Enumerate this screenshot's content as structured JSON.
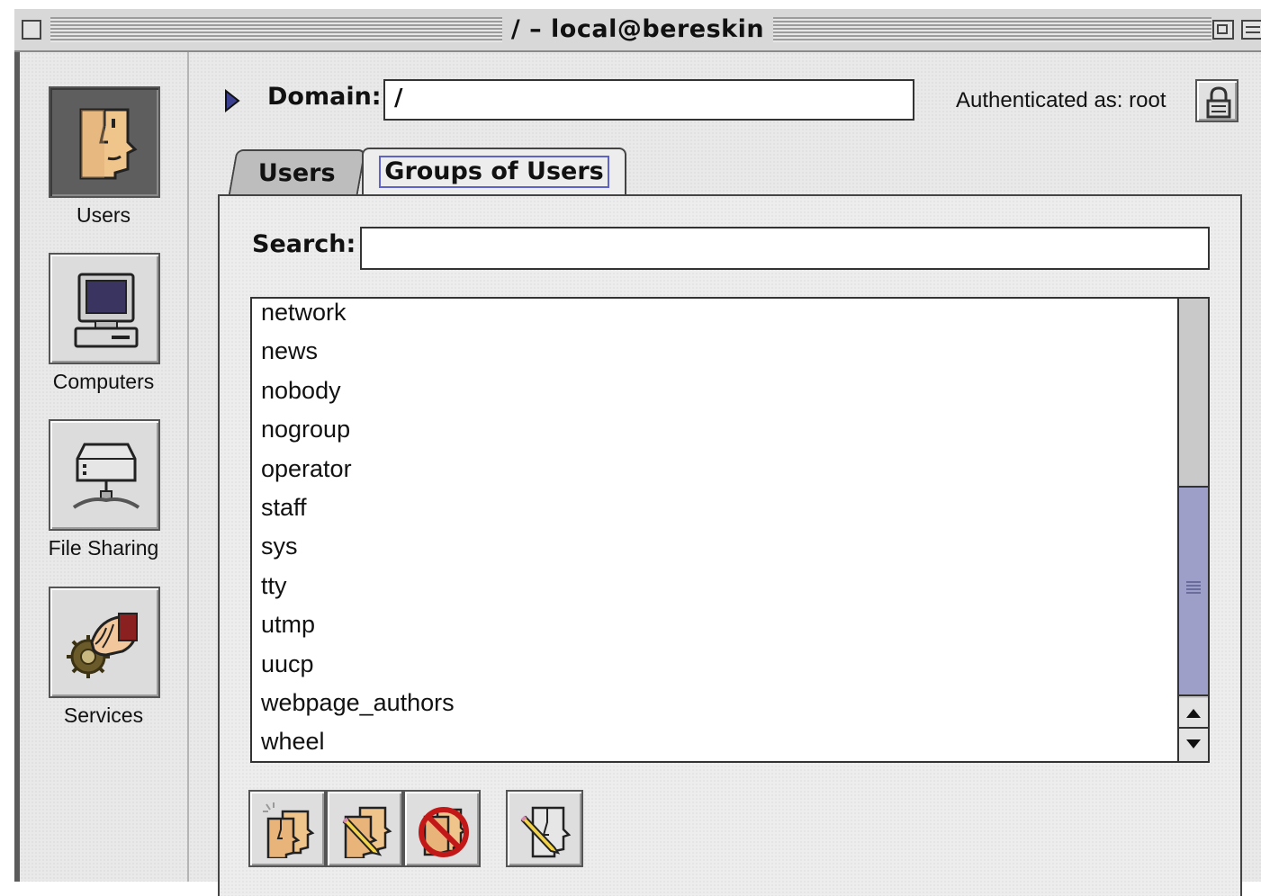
{
  "window": {
    "title": "/ – local@bereskin"
  },
  "sidebar": {
    "items": [
      {
        "label": "Users",
        "icon": "user-face-icon",
        "selected": true
      },
      {
        "label": "Computers",
        "icon": "computer-icon",
        "selected": false
      },
      {
        "label": "File Sharing",
        "icon": "file-server-icon",
        "selected": false
      },
      {
        "label": "Services",
        "icon": "services-hand-icon",
        "selected": false
      }
    ]
  },
  "domain": {
    "label": "Domain:",
    "value": "/"
  },
  "auth": {
    "text": "Authenticated as: root",
    "icon": "lock-icon"
  },
  "tabs": [
    {
      "label": "Users",
      "active": false
    },
    {
      "label": "Groups of Users",
      "active": true
    }
  ],
  "search": {
    "label": "Search:",
    "value": ""
  },
  "groups": [
    "network",
    "news",
    "nobody",
    "nogroup",
    "operator",
    "staff",
    "sys",
    "tty",
    "utmp",
    "uucp",
    "webpage_authors",
    "wheel"
  ],
  "toolbar": [
    {
      "icon": "new-group-icon"
    },
    {
      "icon": "edit-group-icon"
    },
    {
      "icon": "delete-group-icon"
    },
    {
      "icon": "duplicate-edit-icon"
    }
  ],
  "colors": {
    "selection_outline": "#5d63c9",
    "scroll_thumb": "#9d9fc9",
    "face": "#f0c58c"
  }
}
